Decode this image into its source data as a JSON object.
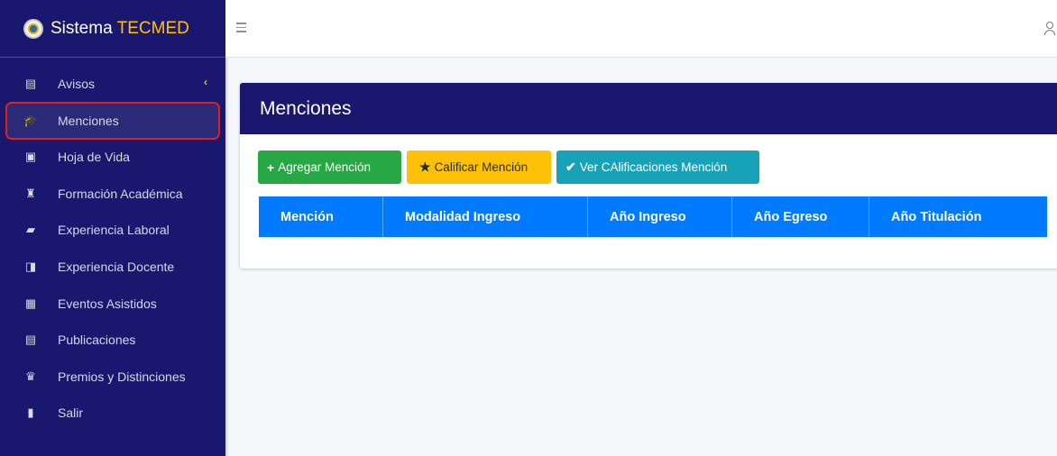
{
  "brand": {
    "name": "Sistema",
    "accent": "TECMED",
    "logo_icon": "tecmed-seal-logo"
  },
  "sidebar": {
    "items": [
      {
        "label": "Avisos",
        "icon": "clipboard-icon",
        "glyph": "▤"
      },
      {
        "label": "Menciones",
        "icon": "graduation-cap-icon",
        "glyph": "🎓"
      },
      {
        "label": "Hoja de Vida",
        "icon": "id-card-icon",
        "glyph": "▣"
      },
      {
        "label": "Formación Académica",
        "icon": "user-graduate-icon",
        "glyph": "♜"
      },
      {
        "label": "Experiencia Laboral",
        "icon": "briefcase-icon",
        "glyph": "▰"
      },
      {
        "label": "Experiencia Docente",
        "icon": "chalkboard-teacher-icon",
        "glyph": "◨"
      },
      {
        "label": "Eventos Asistidos",
        "icon": "calendar-check-icon",
        "glyph": "▦"
      },
      {
        "label": "Publicaciones",
        "icon": "book-icon",
        "glyph": "▤"
      },
      {
        "label": "Premios y Distinciones",
        "icon": "award-icon",
        "glyph": "♛"
      },
      {
        "label": "Salir",
        "icon": "door-open-icon",
        "glyph": "▮"
      }
    ],
    "chevron": "‹"
  },
  "main": {
    "title": "Menciones",
    "buttons": {
      "add": {
        "label": "Agregar Mención",
        "icon": "+"
      },
      "grade": {
        "label": "Calificar Mención",
        "icon": "★"
      },
      "view": {
        "label": "Ver CAlificaciones Mención",
        "icon": "✔"
      }
    },
    "table": {
      "headers": [
        "Mención",
        "Modalidad Ingreso",
        "Año Ingreso",
        "Año Egreso",
        "Año Titulación"
      ]
    }
  },
  "colors": {
    "sidebar_bg": "#1a186e",
    "brand_accent": "#ffc107",
    "add_button": "#28a745",
    "grade_button": "#ffc107",
    "view_button": "#17a2b8",
    "table_header": "#007bff",
    "active_outline": "#e02020"
  }
}
